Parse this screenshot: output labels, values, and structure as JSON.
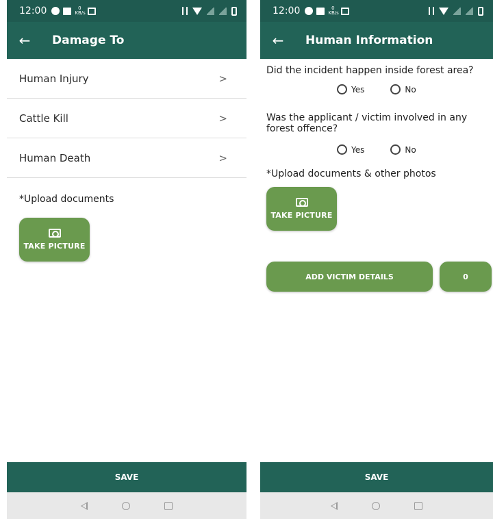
{
  "status_bar": {
    "time": "12:00",
    "kbs": "0 KB/s"
  },
  "left_screen": {
    "title": "Damage To",
    "items": [
      {
        "label": "Human Injury"
      },
      {
        "label": "Cattle Kill"
      },
      {
        "label": "Human Death"
      }
    ],
    "chevron": ">",
    "upload_label": "*Upload documents",
    "take_picture": "TAKE PICTURE",
    "save": "SAVE"
  },
  "right_screen": {
    "title": "Human Information",
    "q1": "Did the incident happen inside forest area?",
    "q2": "Was the applicant / victim involved in any forest offence?",
    "yes": "Yes",
    "no": "No",
    "upload_label": "*Upload documents & other photos",
    "take_picture": "TAKE PICTURE",
    "add_victim": "ADD VICTIM DETAILS",
    "victim_count": "0",
    "save": "SAVE"
  },
  "icons": [
    "back-arrow-icon",
    "chevron-right-icon",
    "camera-icon",
    "radio-unchecked-icon",
    "nav-back-icon",
    "nav-home-icon",
    "nav-recent-icon"
  ],
  "colors": {
    "appbar": "#226357",
    "statusbar": "#1f5a50",
    "button": "#6a9a4e",
    "navbar": "#e8e8e8"
  }
}
